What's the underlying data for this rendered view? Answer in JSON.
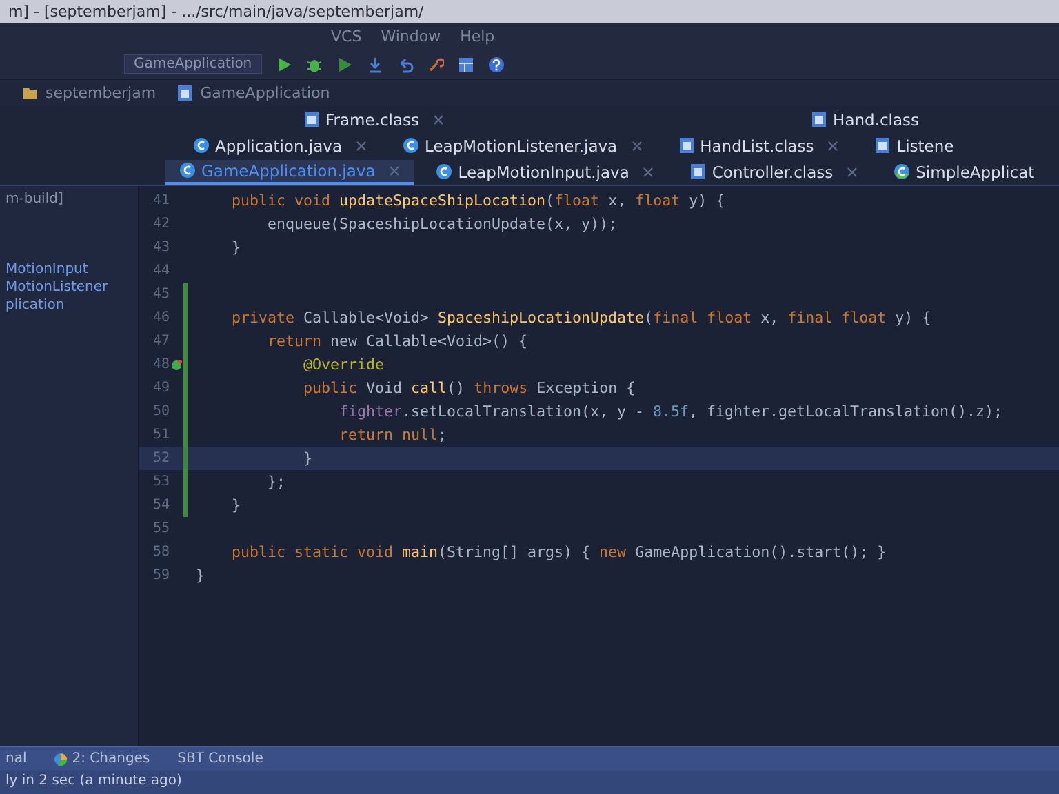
{
  "window": {
    "title": "m] - [septemberjam] - .../src/main/java/septemberjam/"
  },
  "menu": [
    "VCS",
    "Window",
    "Help"
  ],
  "toolbar": {
    "run_config": "GameApplication"
  },
  "breadcrumbs": [
    {
      "label": "septemberjam",
      "kind": "folder"
    },
    {
      "label": "GameApplication",
      "kind": "class"
    }
  ],
  "tab_rows": [
    [
      {
        "label": "Frame.class",
        "kind": "class",
        "selected": false
      },
      {
        "label": "Hand.class",
        "kind": "class",
        "selected": false
      }
    ],
    [
      {
        "label": "Application.java",
        "kind": "java",
        "selected": false
      },
      {
        "label": "LeapMotionListener.java",
        "kind": "java",
        "selected": false
      },
      {
        "label": "HandList.class",
        "kind": "class",
        "selected": false
      },
      {
        "label": "Listene",
        "kind": "class",
        "selected": false
      }
    ],
    [
      {
        "label": "GameApplication.java",
        "kind": "java",
        "selected": true
      },
      {
        "label": "LeapMotionInput.java",
        "kind": "java",
        "selected": false
      },
      {
        "label": "Controller.class",
        "kind": "class",
        "selected": false
      },
      {
        "label": "SimpleApplicat",
        "kind": "app",
        "selected": false
      }
    ]
  ],
  "sidebar": {
    "header": "m-build]",
    "items": [
      {
        "label": "MotionInput"
      },
      {
        "label": "MotionListener"
      },
      {
        "label": "plication"
      }
    ]
  },
  "editor": {
    "lines": [
      {
        "number": "41",
        "changed": false,
        "current": false,
        "marker": false,
        "tokens": [
          {
            "text": "    public void ",
            "kind": "keyword"
          },
          {
            "text": "updateSpaceShipLocation",
            "kind": "method"
          },
          {
            "text": "(",
            "kind": "plain"
          },
          {
            "text": "float ",
            "kind": "keyword"
          },
          {
            "text": "x, ",
            "kind": "plain"
          },
          {
            "text": "float ",
            "kind": "keyword"
          },
          {
            "text": "y) {",
            "kind": "plain"
          }
        ]
      },
      {
        "number": "42",
        "changed": false,
        "current": false,
        "marker": false,
        "tokens": [
          {
            "text": "        enqueue(SpaceshipLocationUpdate(x, y));",
            "kind": "plain"
          }
        ]
      },
      {
        "number": "43",
        "changed": false,
        "current": false,
        "marker": false,
        "tokens": [
          {
            "text": "    }",
            "kind": "plain"
          }
        ]
      },
      {
        "number": "44",
        "changed": false,
        "current": false,
        "marker": false
      },
      {
        "number": "45",
        "changed": true,
        "current": false,
        "marker": false
      },
      {
        "number": "46",
        "changed": true,
        "current": false,
        "marker": false,
        "tokens": [
          {
            "text": "    private ",
            "kind": "keyword"
          },
          {
            "text": "Callable<Void> ",
            "kind": "plain"
          },
          {
            "text": "SpaceshipLocationUpdate",
            "kind": "method"
          },
          {
            "text": "(",
            "kind": "plain"
          },
          {
            "text": "final float ",
            "kind": "keyword"
          },
          {
            "text": "x, ",
            "kind": "plain"
          },
          {
            "text": "final float ",
            "kind": "keyword"
          },
          {
            "text": "y) {",
            "kind": "plain"
          }
        ]
      },
      {
        "number": "47",
        "changed": true,
        "current": false,
        "marker": false,
        "tokens": [
          {
            "text": "        return ",
            "kind": "keyword"
          },
          {
            "text": "new Callable<Void>() {",
            "kind": "plain"
          }
        ]
      },
      {
        "number": "48",
        "changed": true,
        "current": false,
        "marker": true,
        "tokens": [
          {
            "text": "            @Override",
            "kind": "annotation"
          }
        ]
      },
      {
        "number": "49",
        "changed": true,
        "current": false,
        "marker": false,
        "tokens": [
          {
            "text": "            public ",
            "kind": "keyword"
          },
          {
            "text": "Void ",
            "kind": "plain"
          },
          {
            "text": "call",
            "kind": "method"
          },
          {
            "text": "() ",
            "kind": "plain"
          },
          {
            "text": "throws ",
            "kind": "keyword"
          },
          {
            "text": "Exception {",
            "kind": "plain"
          }
        ]
      },
      {
        "number": "50",
        "changed": true,
        "current": false,
        "marker": false,
        "tokens": [
          {
            "text": "                fighter",
            "kind": "field"
          },
          {
            "text": ".setLocalTranslation(x, y - ",
            "kind": "plain"
          },
          {
            "text": "8.5f",
            "kind": "number"
          },
          {
            "text": ", fighter.getLocalTranslation().z);",
            "kind": "plain"
          }
        ]
      },
      {
        "number": "51",
        "changed": true,
        "current": false,
        "marker": false,
        "tokens": [
          {
            "text": "                return null",
            "kind": "keyword"
          },
          {
            "text": ";",
            "kind": "plain"
          }
        ]
      },
      {
        "number": "52",
        "changed": true,
        "current": true,
        "marker": false,
        "tokens": [
          {
            "text": "            }",
            "kind": "plain"
          }
        ]
      },
      {
        "number": "53",
        "changed": true,
        "current": false,
        "marker": false,
        "tokens": [
          {
            "text": "        };",
            "kind": "plain"
          }
        ]
      },
      {
        "number": "54",
        "changed": true,
        "current": false,
        "marker": false,
        "tokens": [
          {
            "text": "    }",
            "kind": "plain"
          }
        ]
      },
      {
        "number": "55",
        "changed": false,
        "current": false,
        "marker": false
      },
      {
        "number": "58",
        "changed": false,
        "current": false,
        "marker": false,
        "tokens": [
          {
            "text": "    public static void ",
            "kind": "keyword"
          },
          {
            "text": "main",
            "kind": "method"
          },
          {
            "text": "(String[] args) { ",
            "kind": "plain"
          },
          {
            "text": "new ",
            "kind": "keyword"
          },
          {
            "text": "GameApplication().start(); }",
            "kind": "plain"
          }
        ]
      },
      {
        "number": "59",
        "changed": false,
        "current": false,
        "marker": false,
        "tokens": [
          {
            "text": "}",
            "kind": "plain"
          }
        ]
      }
    ]
  },
  "tool_tabs": [
    {
      "label": "nal",
      "kind": "plain"
    },
    {
      "label": "2: Changes",
      "kind": "changes"
    },
    {
      "label": "SBT Console",
      "kind": "plain"
    }
  ],
  "status_bar": {
    "text": "ly in 2 sec (a minute ago)"
  }
}
